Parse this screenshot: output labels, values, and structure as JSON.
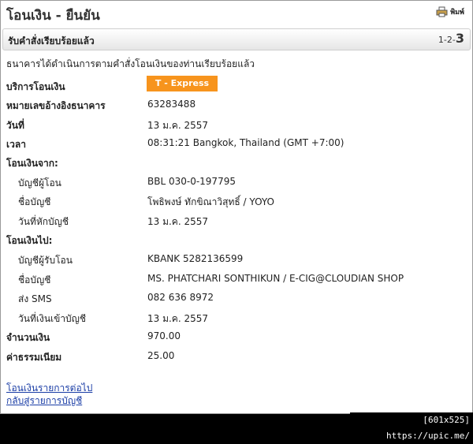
{
  "header": {
    "title": "โอนเงิน - ยืนยัน",
    "print_label": "พิมพ์"
  },
  "step_bar": {
    "title": "รับคำสั่งเรียบร้อยแล้ว",
    "steps_prefix": "1-2-",
    "current_step": "3"
  },
  "message": "ธนาคารได้ดำเนินการตามคำสั่งโอนเงินของท่านเรียบร้อยแล้ว",
  "details": {
    "service_label": "บริการโอนเงิน",
    "service_value": "T - Express",
    "service_badge_color": "#f7941d",
    "reference_label": "หมายเลขอ้างอิงธนาคาร",
    "reference_value": "63283488",
    "date_label": "วันที่",
    "date_value": "13 ม.ค. 2557",
    "time_label": "เวลา",
    "time_value": "08:31:21 Bangkok, Thailand (GMT +7:00)",
    "from_label": "โอนเงินจาก:",
    "from_account_label": "บัญชีผู้โอน",
    "from_account_value": "BBL 030-0-197795",
    "from_name_label": "ชื่อบัญชี",
    "from_name_value": "โพธิพงษ์ ทักขิณาวิสุทธิ์ / YOYO",
    "debit_date_label": "วันที่หักบัญชี",
    "debit_date_value": "13 ม.ค. 2557",
    "to_label": "โอนเงินไป:",
    "to_account_label": "บัญชีผู้รับโอน",
    "to_account_value": "KBANK 5282136599",
    "to_name_label": "ชื่อบัญชี",
    "to_name_value": "MS. PHATCHARI SONTHIKUN / E-CIG@CLOUDIAN SHOP",
    "sms_label": "ส่ง SMS",
    "sms_value": "082 636 8972",
    "credit_date_label": "วันที่เงินเข้าบัญชี",
    "credit_date_value": "13 ม.ค. 2557",
    "amount_label": "จำนวนเงิน",
    "amount_value": "970.00",
    "fee_label": "ค่าธรรมเนียม",
    "fee_value": "25.00"
  },
  "links": {
    "next_transfer": "โอนเงินรายการต่อไป",
    "back_to_accounts": "กลับสู่รายการบัญชี"
  },
  "watermark": "[601x525] https://upic.me/"
}
